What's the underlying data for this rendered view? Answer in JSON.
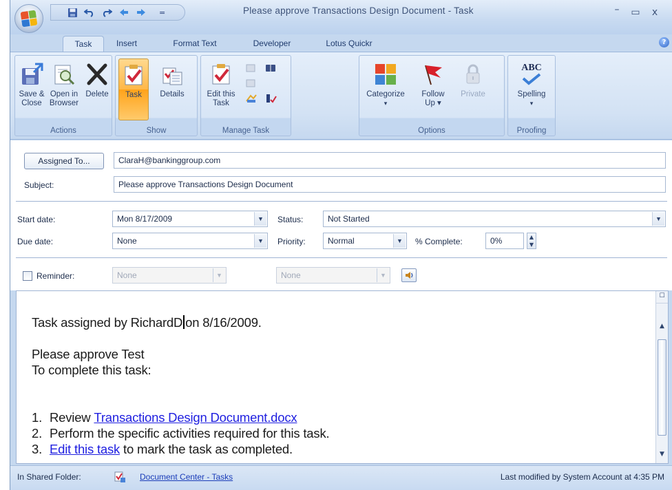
{
  "window": {
    "title": "Please approve Transactions Design Document - Task",
    "minimize": "–",
    "maximize": "▭",
    "close": "x"
  },
  "qat": {
    "items": [
      "save-icon",
      "undo-icon",
      "redo-icon",
      "previous-item-icon",
      "next-item-icon"
    ],
    "customize": "="
  },
  "tabs": [
    "Task",
    "Insert",
    "Format Text",
    "Developer",
    "Lotus Quickr"
  ],
  "active_tab": "Task",
  "ribbon": {
    "groups": {
      "actions": {
        "label": "Actions",
        "save_close_1": "Save &",
        "save_close_2": "Close",
        "open_browser_1": "Open in",
        "open_browser_2": "Browser",
        "delete": "Delete"
      },
      "show": {
        "label": "Show",
        "task": "Task",
        "details": "Details"
      },
      "manage_task": {
        "label": "Manage Task",
        "edit_task_1": "Edit this",
        "edit_task_2": "Task"
      },
      "options": {
        "label": "Options",
        "categorize": "Categorize",
        "follow_up_1": "Follow",
        "follow_up_2": "Up ▾",
        "private": "Private",
        "categorize_arrow": "▾"
      },
      "proofing": {
        "label": "Proofing",
        "spelling": "Spelling",
        "spelling_arrow": "▾",
        "abc": "ABC"
      }
    }
  },
  "form": {
    "assigned_to_button": "Assigned To...",
    "assigned_to_value": "ClaraH@bankinggroup.com",
    "subject_label": "Subject:",
    "subject_value": "Please approve Transactions Design Document",
    "start_date_label": "Start date:",
    "start_date_value": "Mon 8/17/2009",
    "due_date_label": "Due date:",
    "due_date_value": "None",
    "status_label": "Status:",
    "status_value": "Not Started",
    "priority_label": "Priority:",
    "priority_value": "Normal",
    "percent_complete_label": "% Complete:",
    "percent_complete_value": "0%",
    "reminder_label": "Reminder:",
    "reminder_date_value": "None",
    "reminder_time_value": "None"
  },
  "body": {
    "line1_pre": "Task assigned by RichardD",
    "line1_post": "on 8/16/2009.",
    "line2": "Please approve Test",
    "line3": "To complete this task:",
    "steps": [
      {
        "num": "1.",
        "pre": "Review ",
        "link": "Transactions Design Document.docx",
        "post": ""
      },
      {
        "num": "2.",
        "pre": "Perform the specific activities required for this task.",
        "link": "",
        "post": ""
      },
      {
        "num": "3.",
        "pre": "",
        "link": "Edit this task",
        "post": " to mark the task as completed."
      }
    ]
  },
  "statusbar": {
    "folder_label": "In Shared Folder:",
    "folder_link": "Document Center - Tasks",
    "last_modified": "Last modified by System Account at 4:35 PM"
  },
  "colors": {
    "frame": "#c5d8ef",
    "pressed_button": "#ffb748",
    "link": "#2020e0"
  }
}
